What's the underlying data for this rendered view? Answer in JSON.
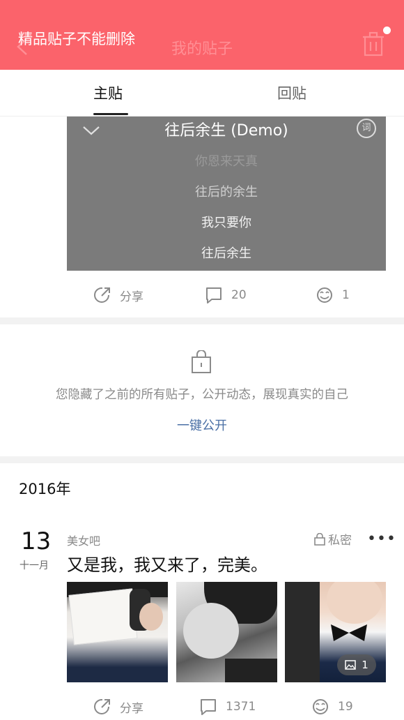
{
  "header": {
    "toast": "精品贴子不能删除",
    "title": "我的贴子"
  },
  "tabs": [
    {
      "label": "主贴"
    },
    {
      "label": "回贴"
    }
  ],
  "lyrics_card": {
    "title": "往后余生 (Demo)",
    "icon_label": "词",
    "lines": [
      "你恩来天真",
      "往后的余生",
      "我只要你",
      "往后余生"
    ]
  },
  "post1_actions": {
    "share": "分享",
    "comments": "20",
    "likes": "1"
  },
  "hidden_notice": {
    "text": "您隐藏了之前的所有贴子，公开动态，展现真实的自己",
    "link": "一键公开"
  },
  "year": "2016年",
  "post2": {
    "day": "13",
    "month": "十一月",
    "forum": "美女吧",
    "privacy": "私密",
    "more": "•••",
    "text": "又是我，我又来了，完美。",
    "image_count": "1",
    "actions": {
      "share": "分享",
      "comments": "1371",
      "likes": "19"
    }
  },
  "colors": {
    "header_bg": "#fb636b",
    "link": "#4a6fa5",
    "muted": "#8a8a8a"
  }
}
